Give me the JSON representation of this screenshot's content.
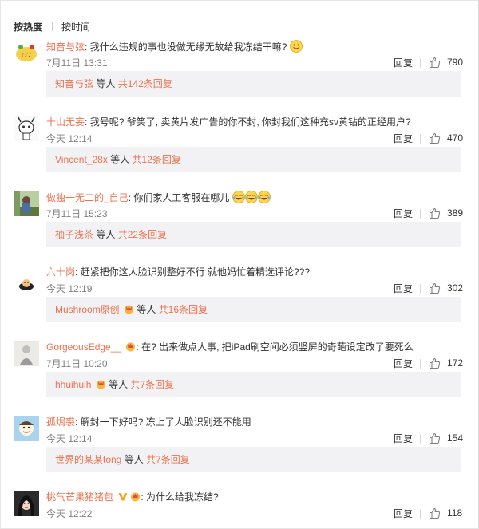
{
  "sort": {
    "hot": "按热度",
    "time": "按时间"
  },
  "labels": {
    "reply": "回复",
    "etc": "等人"
  },
  "colors": {
    "username": "#eb7350",
    "subbox": "#f2f2f5",
    "muted": "#808080"
  },
  "comments": [
    {
      "user": "知音与弦",
      "text": "我什么违规的事也没做无缘无故给我冻结干嘛?",
      "emoji": "smile",
      "time": "7月11日 13:31",
      "likes": "790",
      "sub_user": "知音与弦",
      "sub_total": "共142条回复"
    },
    {
      "user": "十山无妄",
      "text": "我号呢? 爷笑了, 卖黄片发广告的你不封, 你封我们这种充sv黄钻的正经用户?",
      "time": "今天 12:14",
      "likes": "470",
      "sub_user": "Vincent_28x",
      "sub_total": "共12条回复"
    },
    {
      "user": "做独一无二的_自己",
      "text": "你们家人工客服在哪儿",
      "emoji": "crying-laugh x3",
      "time": "7月11日 15:23",
      "likes": "389",
      "sub_user": "柚子浅茶",
      "sub_total": "共22条回复"
    },
    {
      "user": "六十岗",
      "text": "赶紧把你这人脸识别整好不行 就他妈忙着精选评论???",
      "time": "今天 12:19",
      "likes": "302",
      "sub_user": "Mushroom原创",
      "sub_total": "共16条回复"
    },
    {
      "user": "GorgeousEdge__",
      "text": "在? 出来做点人事, 把iPad刷空间必须竖屏的奇葩设定改了要死么",
      "time": "7月11日 10:20",
      "likes": "172",
      "sub_user": "hhuihuih",
      "sub_total": "共7条回复"
    },
    {
      "user": "孤焗裘",
      "text": "解封一下好吗? 冻上了人脸识别还不能用",
      "time": "今天 12:14",
      "likes": "154",
      "sub_user": "世界的某某tong",
      "sub_total": "共7条回复"
    },
    {
      "user": "桃气芒果猪猪包",
      "text": "为什么给我冻结?",
      "time": "今天 12:22",
      "likes": "118"
    }
  ]
}
